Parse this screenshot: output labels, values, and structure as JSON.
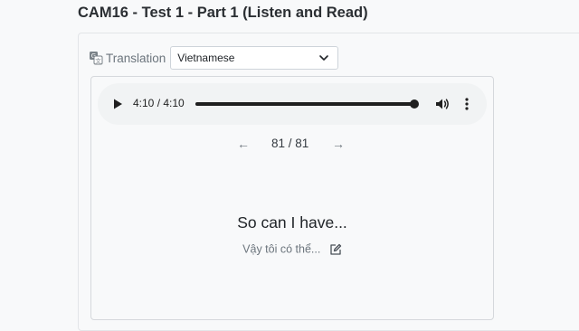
{
  "page": {
    "title": "CAM16 - Test 1 - Part 1 (Listen and Read)"
  },
  "translation": {
    "label": "Translation",
    "label_icon": "translate-icon",
    "selected_language": "Vietnamese",
    "dropdown_icon": "chevron-down-icon"
  },
  "audio": {
    "time_display": "4:10 / 4:10",
    "progress_fraction": 1.0,
    "play_icon": "play-icon",
    "volume_icon": "volume-icon",
    "menu_icon": "more-vertical-icon"
  },
  "pager": {
    "prev_icon": "arrow-left-icon",
    "counter": "81 / 81",
    "next_icon": "arrow-right-icon"
  },
  "sentence": {
    "text": "So can I have...",
    "translation": "Vậy tôi có thể...",
    "edit_icon": "edit-icon"
  },
  "colors": {
    "background": "#f8f9fa",
    "player_background": "#f1f3f4",
    "muted_text": "#6c757d"
  }
}
